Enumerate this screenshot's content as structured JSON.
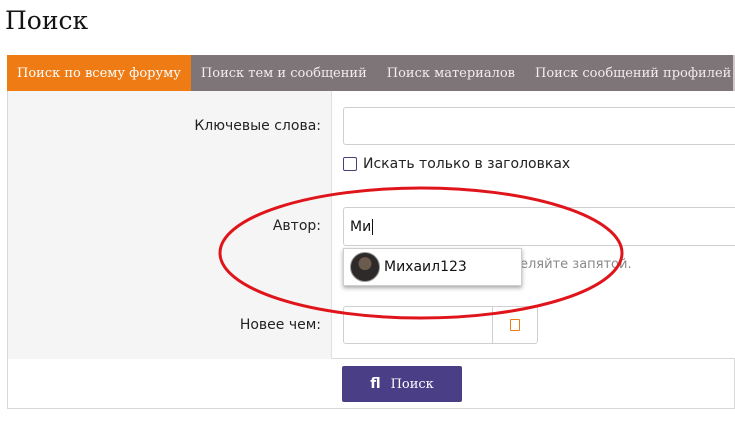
{
  "page": {
    "title": "Поиск"
  },
  "tabs": [
    {
      "label": "Поиск по всему форуму",
      "active": true
    },
    {
      "label": "Поиск тем и сообщений",
      "active": false
    },
    {
      "label": "Поиск материалов",
      "active": false
    },
    {
      "label": "Поиск сообщений профилей",
      "active": false
    }
  ],
  "form": {
    "keywords": {
      "label": "Ключевые слова:",
      "value": ""
    },
    "titles_only": {
      "label": "Искать только в заголовках",
      "checked": false
    },
    "author": {
      "label": "Автор:",
      "value": "Ми",
      "hint": "еляйте запятой."
    },
    "autocomplete": {
      "suggestion": "Михаил123"
    },
    "newer_than": {
      "label": "Новее чем:",
      "value": "",
      "icon": "calendar-icon"
    }
  },
  "actions": {
    "search_label": "Поиск",
    "search_icon": "ﬂ"
  },
  "colors": {
    "active_tab": "#ee7b14",
    "tab_bar": "#7e7578",
    "button": "#4a3f87",
    "annotation": "#e0151b"
  }
}
